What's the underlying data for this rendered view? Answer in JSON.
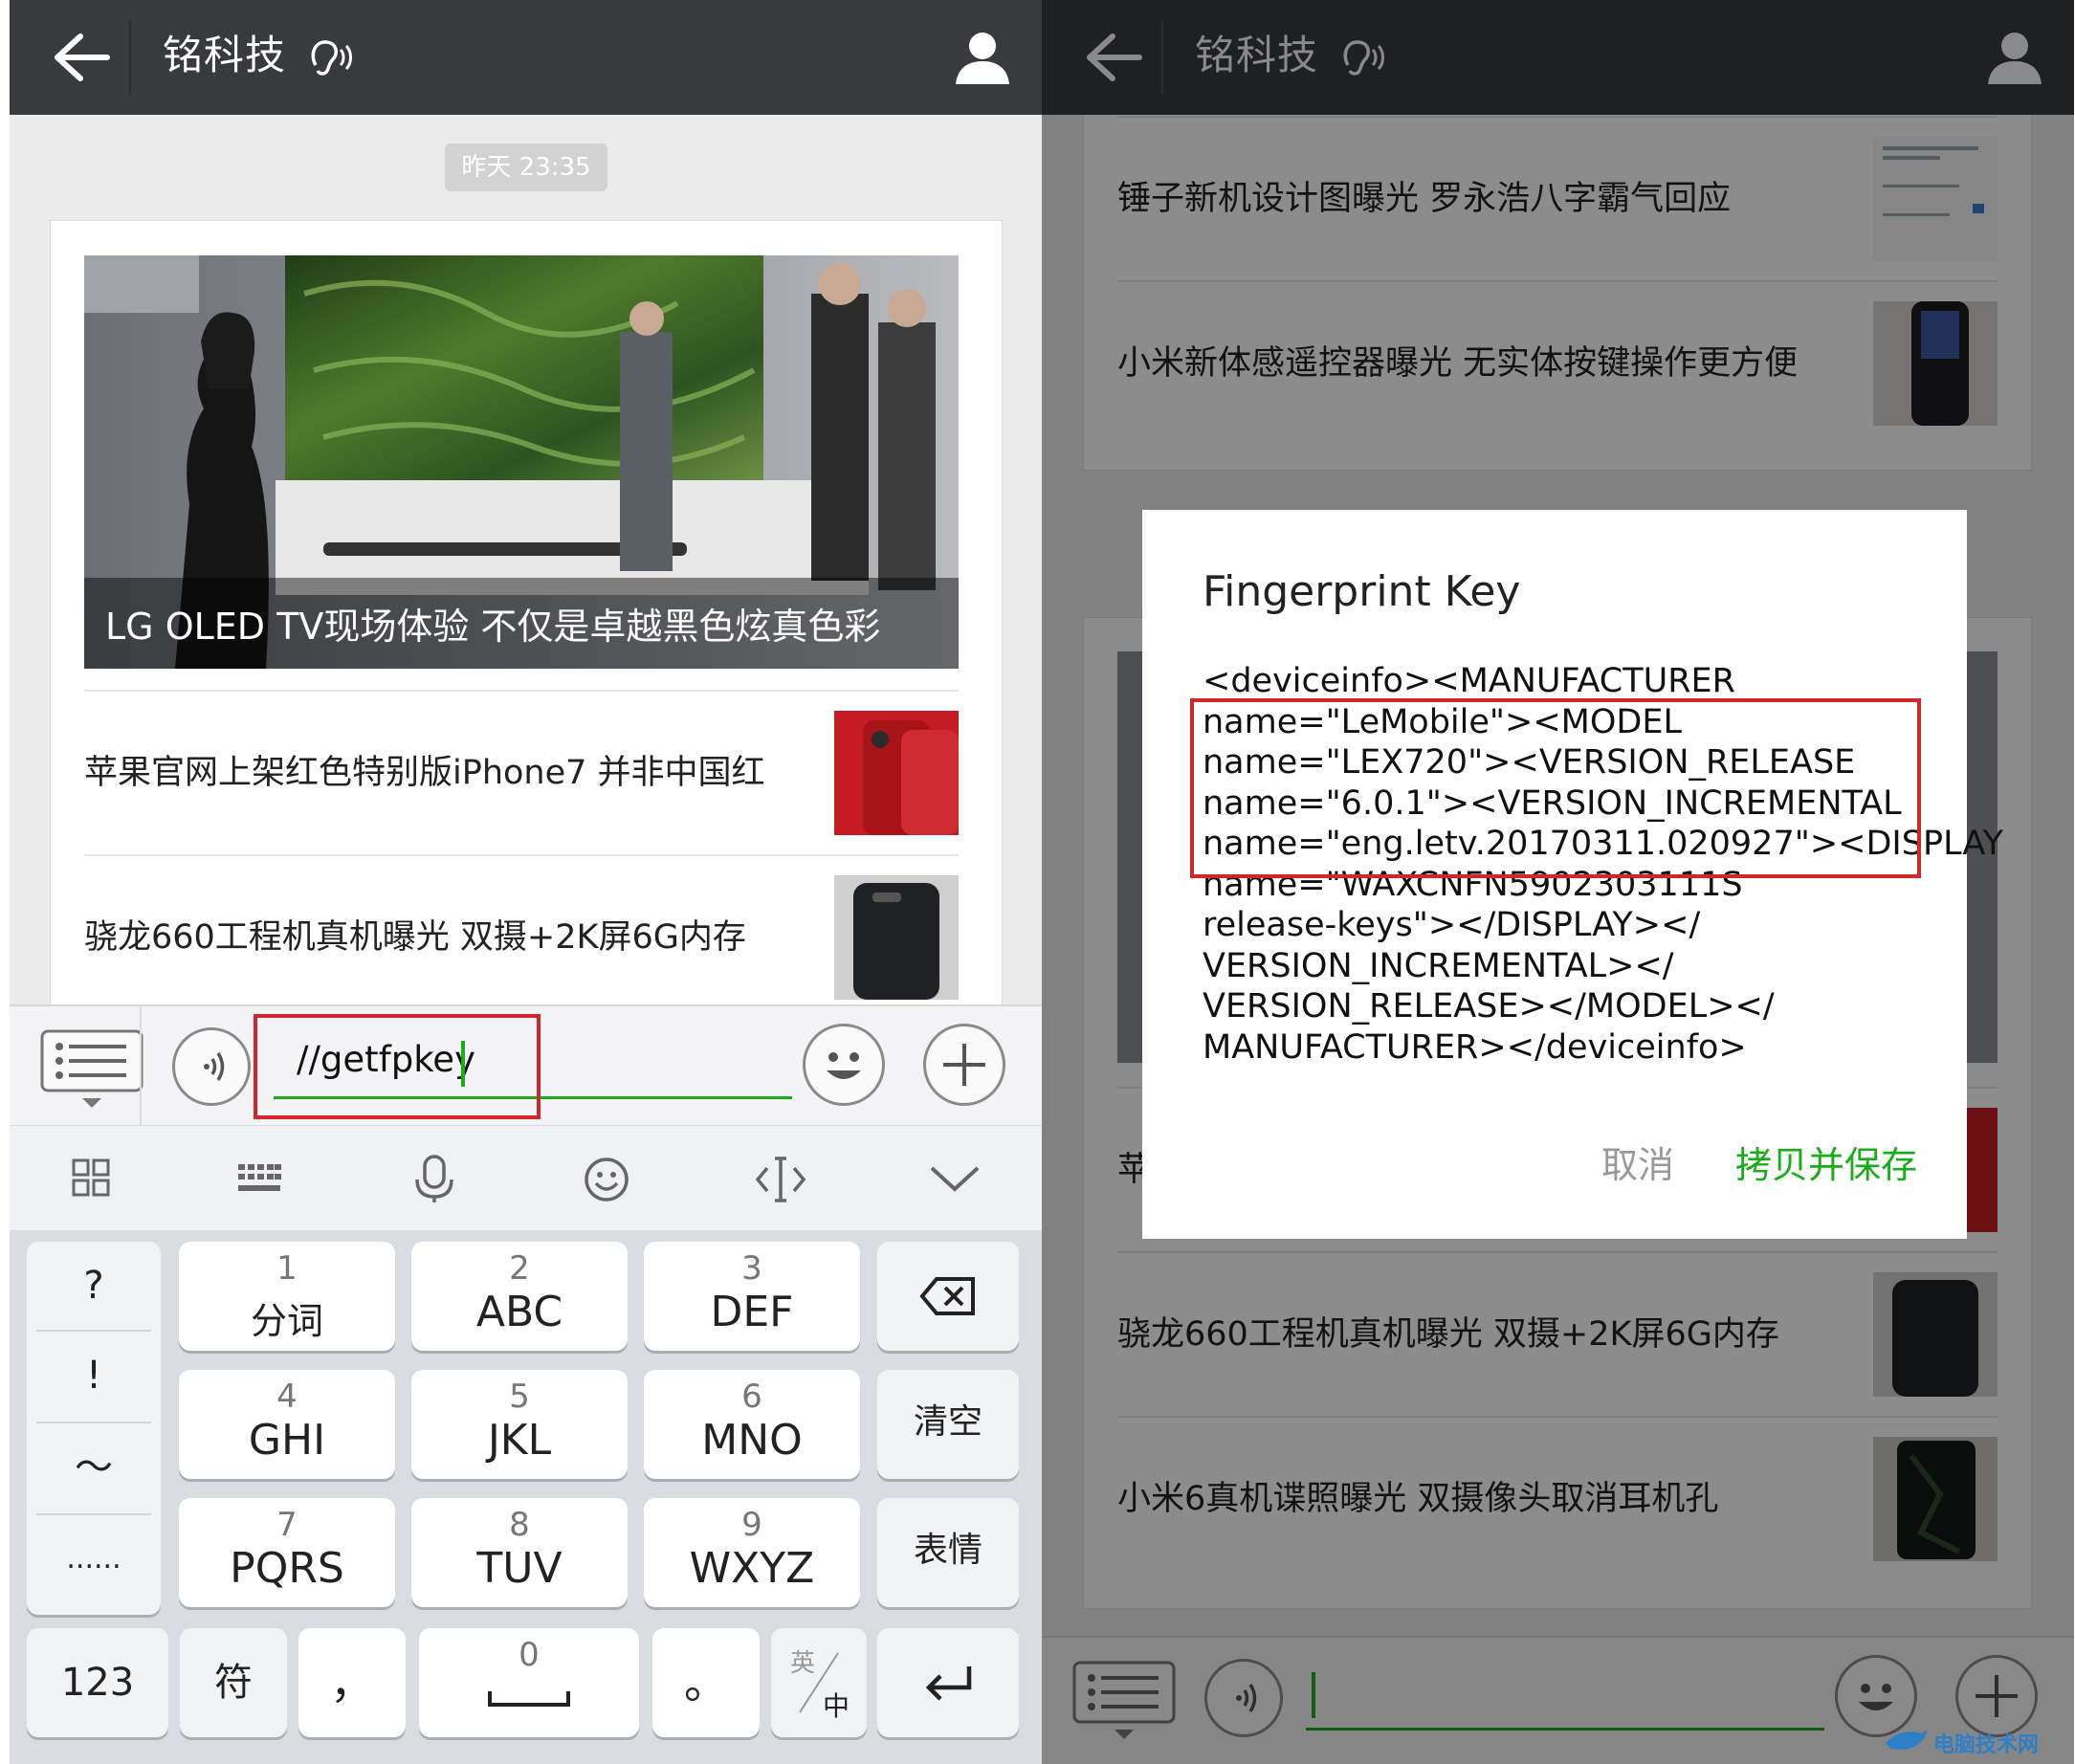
{
  "left": {
    "header": {
      "title": "铭科技"
    },
    "timestamp": "昨天 23:35",
    "hero": {
      "caption": "LG OLED TV现场体验 不仅是卓越黑色炫真色彩"
    },
    "news": [
      {
        "title": "苹果官网上架红色特别版iPhone7 并非中国红"
      },
      {
        "title": "骁龙660工程机真机曝光 双摄+2K屏6G内存"
      }
    ],
    "input": {
      "value": "//getfpkey"
    },
    "keyboard": {
      "left_col": [
        "?",
        "!",
        "～",
        "......"
      ],
      "keys": [
        {
          "num": "1",
          "label": "分词"
        },
        {
          "num": "2",
          "label": "ABC"
        },
        {
          "num": "3",
          "label": "DEF"
        },
        {
          "num": "4",
          "label": "GHI"
        },
        {
          "num": "5",
          "label": "JKL"
        },
        {
          "num": "6",
          "label": "MNO"
        },
        {
          "num": "7",
          "label": "PQRS"
        },
        {
          "num": "8",
          "label": "TUV"
        },
        {
          "num": "9",
          "label": "WXYZ"
        }
      ],
      "clear": "清空",
      "emoji": "表情",
      "num_mode": "123",
      "symbol": "符",
      "comma": "，",
      "space_num": "0",
      "period": "。",
      "lang_en": "英",
      "lang_zh": "中"
    }
  },
  "right": {
    "header": {
      "title": "铭科技"
    },
    "news": [
      {
        "title": "锤子新机设计图曝光 罗永浩八字霸气回应"
      },
      {
        "title": "小米新体感遥控器曝光 无实体按键操作更方便"
      },
      {
        "title": "苹"
      },
      {
        "title": "骁龙660工程机真机曝光 双摄+2K屏6G内存"
      },
      {
        "title": "小米6真机谍照曝光 双摄像头取消耳机孔"
      }
    ],
    "dialog": {
      "title": "Fingerprint Key",
      "lines": [
        "<deviceinfo><MANUFACTURER",
        "name=\"LeMobile\"><MODEL",
        "name=\"LEX720\"><VERSION_RELEASE",
        "name=\"6.0.1\"><VERSION_INCREMENTAL",
        "name=\"eng.letv.20170311.020927\"><DISPLAY",
        "name=\"WAXCNFN5902303111S",
        "release-keys\"></DISPLAY></",
        "VERSION_INCREMENTAL></",
        "VERSION_RELEASE></MODEL></",
        "MANUFACTURER></deviceinfo>"
      ],
      "cancel": "取消",
      "confirm": "拷贝并保存"
    },
    "watermark": "电脑技术网"
  },
  "colors": {
    "header_bg": "#393a3e",
    "accent_green": "#1aad19",
    "highlight_red": "#d0262e"
  },
  "icons": [
    "back-arrow-icon",
    "ear-icon",
    "user-profile-icon",
    "menu-list-icon",
    "voice-icon",
    "smile-emoji-icon",
    "plus-icon",
    "grid-icon",
    "keyboard-icon",
    "mic-icon",
    "emoji-icon",
    "cursor-move-icon",
    "chevron-down-icon",
    "backspace-icon",
    "enter-icon"
  ]
}
